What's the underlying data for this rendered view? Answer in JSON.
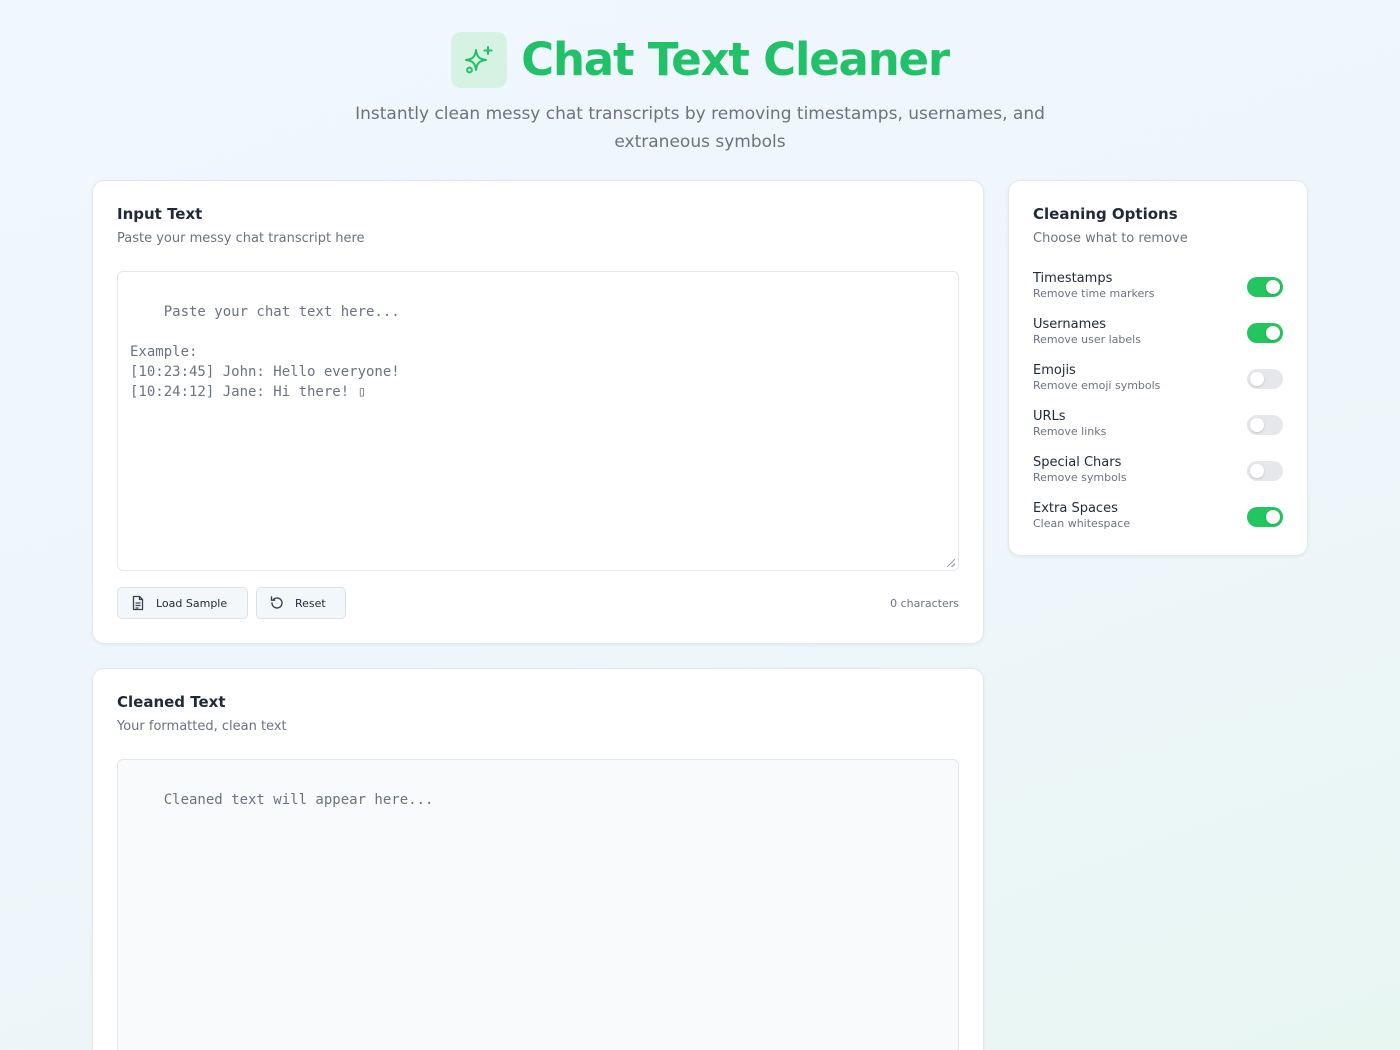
{
  "header": {
    "title": "Chat Text Cleaner",
    "subtitle": "Instantly clean messy chat transcripts by removing timestamps, usernames, and extraneous symbols",
    "logo_icon": "sparkles-icon",
    "accent_color": "#22c068"
  },
  "input_card": {
    "title": "Input Text",
    "subtitle": "Paste your messy chat transcript here",
    "placeholder": "Paste your chat text here...\n\nExample:\n[10:23:45] John: Hello everyone!\n[10:24:12] Jane: Hi there! ▯",
    "value": "",
    "load_sample_label": "Load Sample",
    "reset_label": "Reset",
    "char_count": "0 characters"
  },
  "output_card": {
    "title": "Cleaned Text",
    "subtitle": "Your formatted, clean text",
    "placeholder": "Cleaned text will appear here..."
  },
  "options": {
    "title": "Cleaning Options",
    "subtitle": "Choose what to remove",
    "items": [
      {
        "label": "Timestamps",
        "desc": "Remove time markers",
        "enabled": true
      },
      {
        "label": "Usernames",
        "desc": "Remove user labels",
        "enabled": true
      },
      {
        "label": "Emojis",
        "desc": "Remove emoji symbols",
        "enabled": false
      },
      {
        "label": "URLs",
        "desc": "Remove links",
        "enabled": false
      },
      {
        "label": "Special Chars",
        "desc": "Remove symbols",
        "enabled": false
      },
      {
        "label": "Extra Spaces",
        "desc": "Clean whitespace",
        "enabled": true
      }
    ]
  }
}
